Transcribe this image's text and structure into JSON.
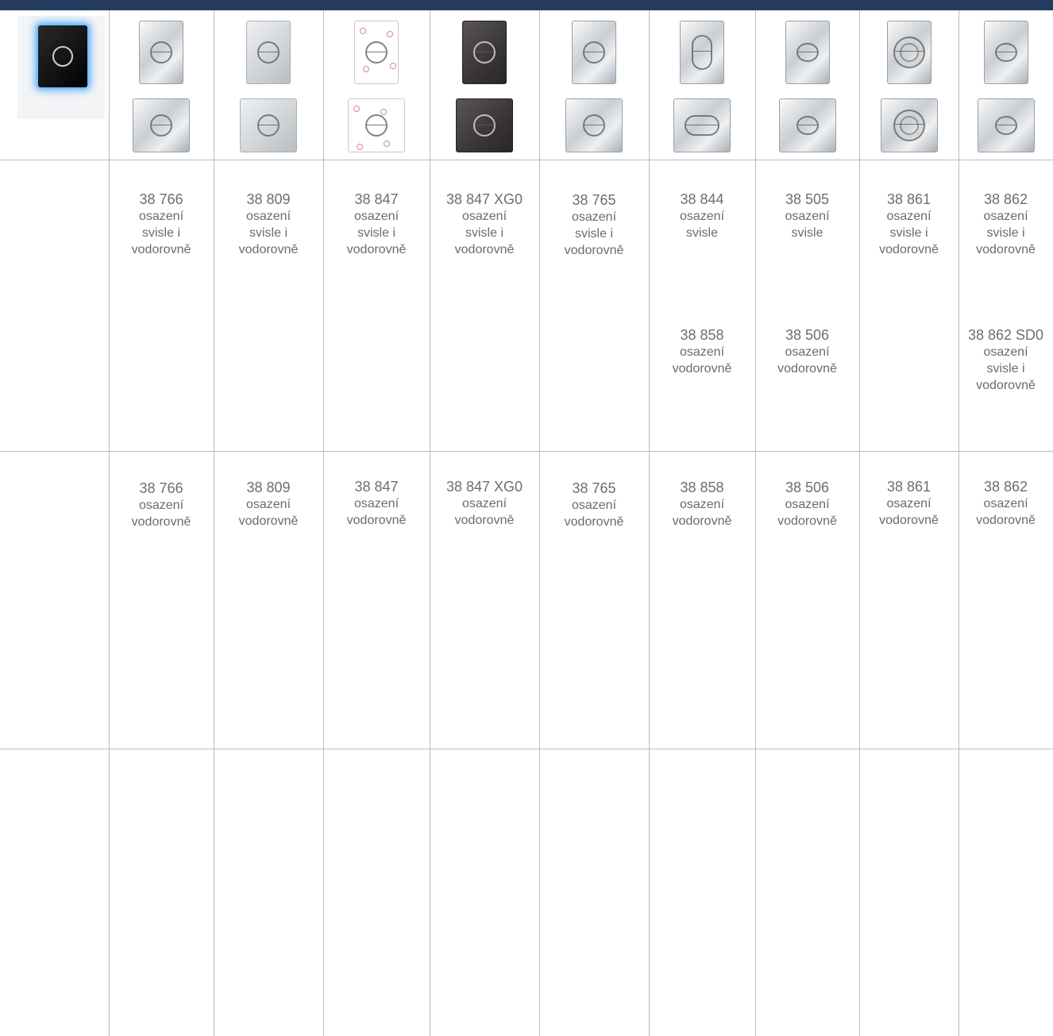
{
  "row1": [
    {
      "code": "38 766",
      "lines": [
        "osazení",
        "svisle i",
        "vodorovně"
      ]
    },
    {
      "code": "38 809",
      "lines": [
        "osazení",
        "svisle i",
        "vodorovně"
      ]
    },
    {
      "code": "38 847",
      "lines": [
        "osazení",
        "svisle i",
        "vodorovně"
      ]
    },
    {
      "code": "38 847 XG0",
      "lines": [
        "osazení",
        "svisle i",
        "vodorovně"
      ]
    },
    {
      "code": "38 765",
      "lines": [
        "osazení",
        "svisle i",
        "vodorovně"
      ]
    },
    {
      "code": "38 844",
      "lines": [
        "osazení",
        "svisle"
      ]
    },
    {
      "code": "38 505",
      "lines": [
        "osazení",
        "svisle"
      ]
    },
    {
      "code": "38 861",
      "lines": [
        "osazení",
        "svisle i",
        "vodorovně"
      ]
    },
    {
      "code": "38 862",
      "lines": [
        "osazení",
        "svisle i",
        "vodorovně"
      ]
    }
  ],
  "row1_second": [
    {
      "code": "38 858",
      "lines": [
        "osazení",
        "vodorovně"
      ]
    },
    {
      "code": "38 506",
      "lines": [
        "osazení",
        "vodorovně"
      ]
    },
    {
      "code": "38 862 SD0",
      "lines": [
        "osazení",
        "svisle i",
        "vodorovně"
      ]
    }
  ],
  "row2": [
    {
      "code": "38 766",
      "lines": [
        "osazení",
        "vodorovně"
      ]
    },
    {
      "code": "38 809",
      "lines": [
        "osazení",
        "vodorovně"
      ]
    },
    {
      "code": "38 847",
      "lines": [
        "osazení",
        "vodorovně"
      ]
    },
    {
      "code": "38 847 XG0",
      "lines": [
        "osazení",
        "vodorovně"
      ]
    },
    {
      "code": "38 765",
      "lines": [
        "osazení",
        "vodorovně"
      ]
    },
    {
      "code": "38 858",
      "lines": [
        "osazení",
        "vodorovně"
      ]
    },
    {
      "code": "38 506",
      "lines": [
        "osazení",
        "vodorovně"
      ]
    },
    {
      "code": "38 861",
      "lines": [
        "osazení",
        "vodorovně"
      ]
    },
    {
      "code": "38 862",
      "lines": [
        "osazení",
        "vodorovně"
      ]
    }
  ],
  "images": {
    "first": "illuminated-glass-flush-plate",
    "plates": [
      "chrome",
      "matte",
      "white",
      "dark",
      "chrome",
      "chrome",
      "chrome",
      "chrome",
      "chrome"
    ],
    "colors": {
      "header_bar": "#243a5e",
      "glow": "#5fb3ff"
    }
  }
}
